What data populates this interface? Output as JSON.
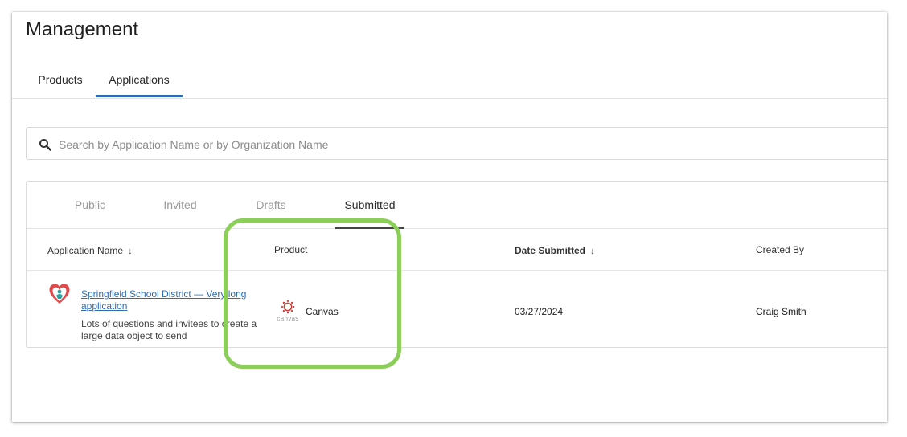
{
  "page": {
    "title": "Management"
  },
  "main_tabs": [
    {
      "label": "Products",
      "active": false
    },
    {
      "label": "Applications",
      "active": true
    }
  ],
  "search": {
    "placeholder": "Search by Application Name or by Organization Name",
    "value": "",
    "icon": "search-icon"
  },
  "sub_tabs": [
    {
      "label": "Public",
      "active": false
    },
    {
      "label": "Invited",
      "active": false
    },
    {
      "label": "Drafts",
      "active": false
    },
    {
      "label": "Submitted",
      "active": true
    }
  ],
  "table": {
    "columns": [
      {
        "label": "Application Name",
        "sortable": true,
        "sort": "desc"
      },
      {
        "label": "Product",
        "sortable": false
      },
      {
        "label": "Date Submitted",
        "sortable": true,
        "sort": "desc"
      },
      {
        "label": "Created By",
        "sortable": false
      }
    ],
    "rows": [
      {
        "app_name": "Springfield School District — Very long application",
        "description": "Lots of questions and invitees to create a large data object to send",
        "product": "Canvas",
        "product_logo_text": "canvas",
        "date_submitted": "03/27/2024",
        "created_by": "Craig Smith"
      }
    ]
  },
  "colors": {
    "accent": "#2e6db5",
    "highlight": "#8cce5a",
    "canvas_red": "#e2332b",
    "org_logo_red": "#e04a4a",
    "org_logo_teal": "#2aa3a0"
  }
}
